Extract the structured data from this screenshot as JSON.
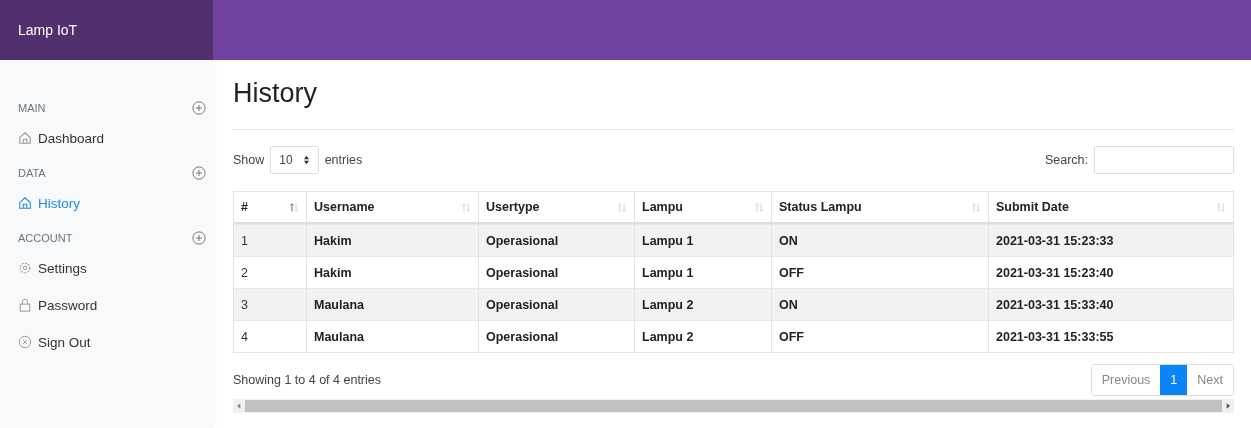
{
  "brand": "Lamp IoT",
  "sidebar": {
    "sections": [
      {
        "label": "MAIN",
        "items": [
          {
            "label": "Dashboard",
            "kind": "home",
            "selected": false
          }
        ]
      },
      {
        "label": "DATA",
        "items": [
          {
            "label": "History",
            "kind": "home",
            "selected": true
          }
        ]
      },
      {
        "label": "ACCOUNT",
        "items": [
          {
            "label": "Settings",
            "kind": "gear",
            "selected": false
          },
          {
            "label": "Password",
            "kind": "lock",
            "selected": false
          },
          {
            "label": "Sign Out",
            "kind": "close",
            "selected": false
          }
        ]
      }
    ]
  },
  "page_title": "History",
  "length_control": {
    "before": "Show",
    "value": "10",
    "after": "entries"
  },
  "search": {
    "label": "Search:"
  },
  "table": {
    "columns": [
      {
        "label": "#",
        "sorted": true
      },
      {
        "label": "Username",
        "sorted": false
      },
      {
        "label": "Usertype",
        "sorted": false
      },
      {
        "label": "Lampu",
        "sorted": false
      },
      {
        "label": "Status Lampu",
        "sorted": false
      },
      {
        "label": "Submit Date",
        "sorted": false
      }
    ],
    "rows": [
      [
        "1",
        "Hakim",
        "Operasional",
        "Lampu 1",
        "ON",
        "2021-03-31 15:23:33"
      ],
      [
        "2",
        "Hakim",
        "Operasional",
        "Lampu 1",
        "OFF",
        "2021-03-31 15:23:40"
      ],
      [
        "3",
        "Maulana",
        "Operasional",
        "Lampu 2",
        "ON",
        "2021-03-31 15:33:40"
      ],
      [
        "4",
        "Maulana",
        "Operasional",
        "Lampu 2",
        "OFF",
        "2021-03-31 15:33:55"
      ]
    ]
  },
  "info": "Showing 1 to 4 of 4 entries",
  "pagination": [
    {
      "label": "Previous",
      "selected": false
    },
    {
      "label": "1",
      "selected": true
    },
    {
      "label": "Next",
      "selected": false
    }
  ]
}
